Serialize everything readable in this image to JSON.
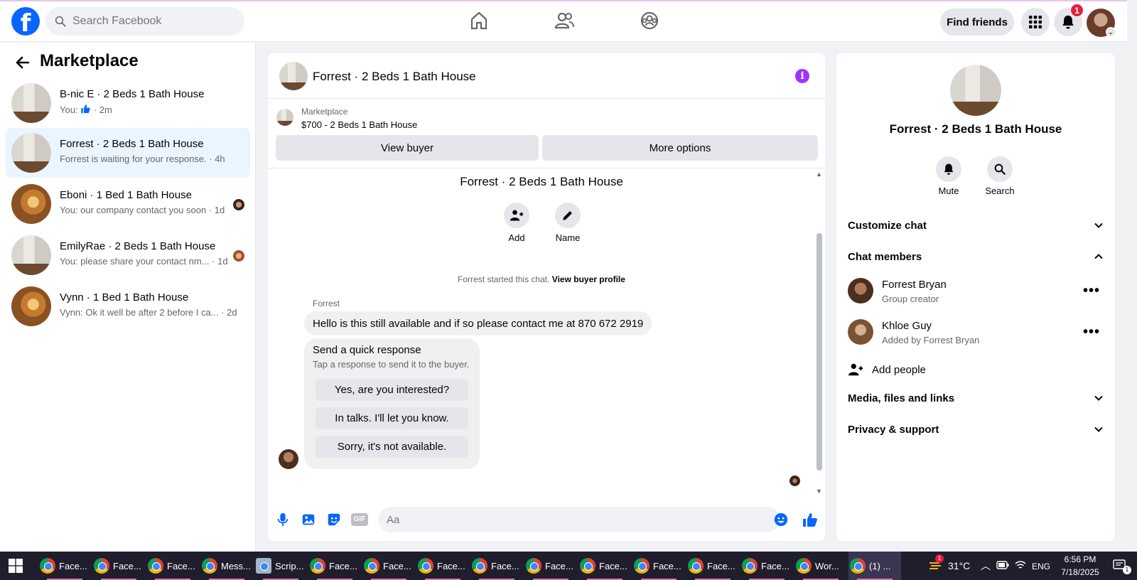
{
  "topbar": {
    "logo": "f",
    "search_placeholder": "Search Facebook",
    "find_friends": "Find friends",
    "notification_count": "1"
  },
  "sidebar": {
    "title": "Marketplace",
    "conversations": [
      {
        "title": "B-nic E · 2 Beds 1 Bath House",
        "sub_prefix": "You:",
        "sub_time": "· 2m",
        "thumb": "house"
      },
      {
        "title": "Forrest · 2 Beds 1 Bath House",
        "sub": "Forrest is waiting for your response. · 4h",
        "thumb": "house"
      },
      {
        "title": "Eboni · 1 Bed 1 Bath House",
        "sub": "You: our company contact you soon · 1d",
        "thumb": "room"
      },
      {
        "title": "EmilyRae · 2 Beds 1 Bath House",
        "sub": "You: please share your contact nm... · 1d",
        "thumb": "house"
      },
      {
        "title": "Vynn · 1 Bed 1 Bath House",
        "sub": "Vynn: Ok it well be after 2 before I ca... · 2d",
        "thumb": "room"
      }
    ]
  },
  "chat": {
    "header_title": "Forrest · 2 Beds 1 Bath House",
    "info_glyph": "i",
    "marketplace_label": "Marketplace",
    "listing": "$700 - 2 Beds 1 Bath House",
    "view_buyer": "View buyer",
    "more_options": "More options",
    "group_title": "Forrest · 2 Beds 1 Bath House",
    "add_label": "Add",
    "name_label": "Name",
    "started_text": "Forrest started this chat.",
    "view_buyer_profile": "View buyer profile",
    "sender": "Forrest",
    "message": "Hello is this still available and if so please contact me at 870 672 2919",
    "quick_title": "Send a quick response",
    "quick_sub": "Tap a response to send it to the buyer.",
    "quick_replies": [
      "Yes, are you interested?",
      "In talks. I'll let you know.",
      "Sorry, it's not available."
    ],
    "composer_placeholder": "Aa",
    "gif_label": "GIF"
  },
  "info": {
    "title": "Forrest · 2 Beds 1 Bath House",
    "mute": "Mute",
    "search": "Search",
    "customize": "Customize chat",
    "members_header": "Chat members",
    "members": [
      {
        "name": "Forrest Bryan",
        "role": "Group creator"
      },
      {
        "name": "Khloe Guy",
        "role": "Added by Forrest Bryan"
      }
    ],
    "add_people": "Add people",
    "media": "Media, files and links",
    "privacy": "Privacy & support",
    "dots": "•••"
  },
  "taskbar": {
    "apps": [
      "Face...",
      "Face...",
      "Face...",
      "Mess...",
      "Scrip...",
      "Face...",
      "Face...",
      "Face...",
      "Face...",
      "Face...",
      "Face...",
      "Face...",
      "Face...",
      "Face...",
      "Wor...",
      "(1) ..."
    ],
    "temperature": "31°C",
    "weather_badge": "1",
    "language": "ENG",
    "time": "6:56 PM",
    "date": "7/18/2025",
    "notif_count": "1"
  },
  "colors": {
    "brand": "#0866ff",
    "accent_purple": "#a033ff",
    "badge": "#e41e3f"
  }
}
